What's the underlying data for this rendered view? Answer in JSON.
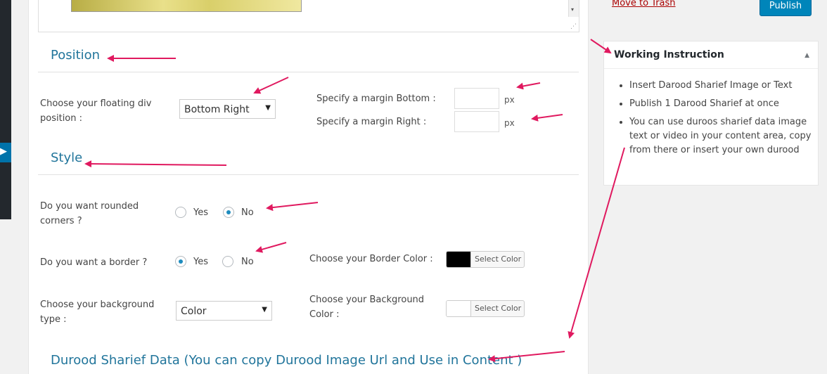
{
  "sidebar": {
    "collapse_icon": "collapse-arrow-icon",
    "collapse_glyph": "▶"
  },
  "editor": {
    "scroll_arrow": "▾",
    "resize_glyph": "⋰"
  },
  "position_section": {
    "title": "Position",
    "floating_label_line1": "Choose your floating div",
    "floating_label_line2": "position :",
    "floating_select_value": "Bottom Right",
    "margin_bottom_label": "Specify a margin Bottom :",
    "margin_right_label": "Specify a margin Right :",
    "unit": "px",
    "margin_bottom_value": "",
    "margin_right_value": ""
  },
  "style_section": {
    "title": "Style",
    "rounded_label_line1": "Do you want rounded",
    "rounded_label_line2": "corners ?",
    "rounded_yes": "Yes",
    "rounded_no": "No",
    "rounded_selected": "No",
    "border_label": "Do you want a border ?",
    "border_yes": "Yes",
    "border_no": "No",
    "border_selected": "Yes",
    "border_color_label": "Choose your Border Color :",
    "border_color_value": "#000000",
    "select_color_label": "Select Color",
    "bg_type_label_line1": "Choose your background",
    "bg_type_label_line2": "type :",
    "bg_type_value": "Color",
    "bg_color_label_line1": "Choose your Background",
    "bg_color_label_line2": "Color :",
    "bg_color_value": "#ffffff"
  },
  "data_section": {
    "title": "Durood Sharief Data (You can copy Durood Image Url and Use in Content )"
  },
  "publish_box": {
    "trash_label": "Move to Trash",
    "publish_label": "Publish"
  },
  "instructions": {
    "title": "Working Instruction",
    "toggle_glyph": "▲",
    "items": [
      "Insert Darood Sharief Image or Text",
      "Publish 1 Darood Sharief at once",
      "You can use duroos sharief data image text or video in your content area, copy from there or insert your own durood"
    ]
  },
  "colors": {
    "accent": "#21759b",
    "annotation_arrow": "#e0195f",
    "publish": "#0085ba",
    "trash": "#a00000"
  }
}
